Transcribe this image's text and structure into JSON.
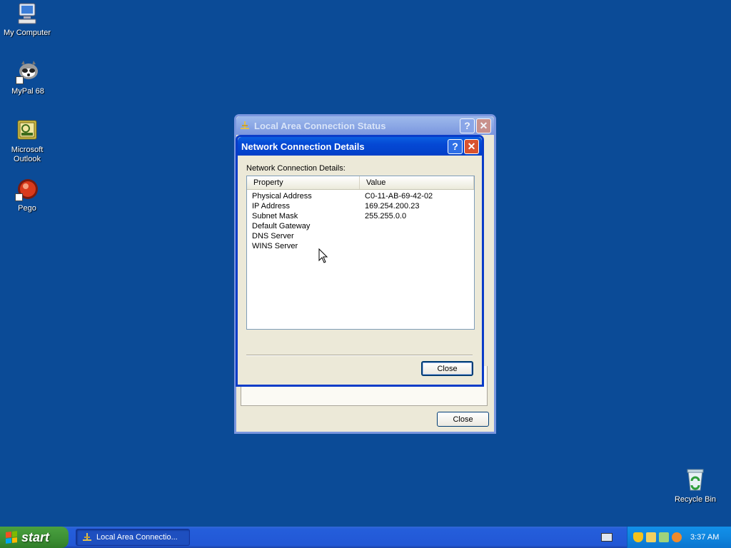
{
  "desktop": {
    "icons": [
      {
        "label": "My Computer"
      },
      {
        "label": "MyPal 68"
      },
      {
        "label": "Microsoft Outlook"
      },
      {
        "label": "Pego"
      },
      {
        "label": "Recycle Bin"
      }
    ]
  },
  "status_window": {
    "title": "Local Area Connection Status",
    "close_label": "Close"
  },
  "details_dialog": {
    "title": "Network Connection Details",
    "section_label": "Network Connection Details:",
    "columns": [
      "Property",
      "Value"
    ],
    "rows": [
      {
        "property": "Physical Address",
        "value": "C0-11-AB-69-42-02"
      },
      {
        "property": "IP Address",
        "value": "169.254.200.23"
      },
      {
        "property": "Subnet Mask",
        "value": "255.255.0.0"
      },
      {
        "property": "Default Gateway",
        "value": ""
      },
      {
        "property": "DNS Server",
        "value": ""
      },
      {
        "property": "WINS Server",
        "value": ""
      }
    ],
    "close_label": "Close"
  },
  "taskbar": {
    "start_label": "start",
    "task_label": "Local Area Connectio...",
    "clock": "3:37 AM"
  },
  "colors": {
    "desktop": "#0b4b97",
    "title_active": "#0548d4",
    "start_green": "#3c8f34",
    "tray_blue": "#0f85de"
  }
}
